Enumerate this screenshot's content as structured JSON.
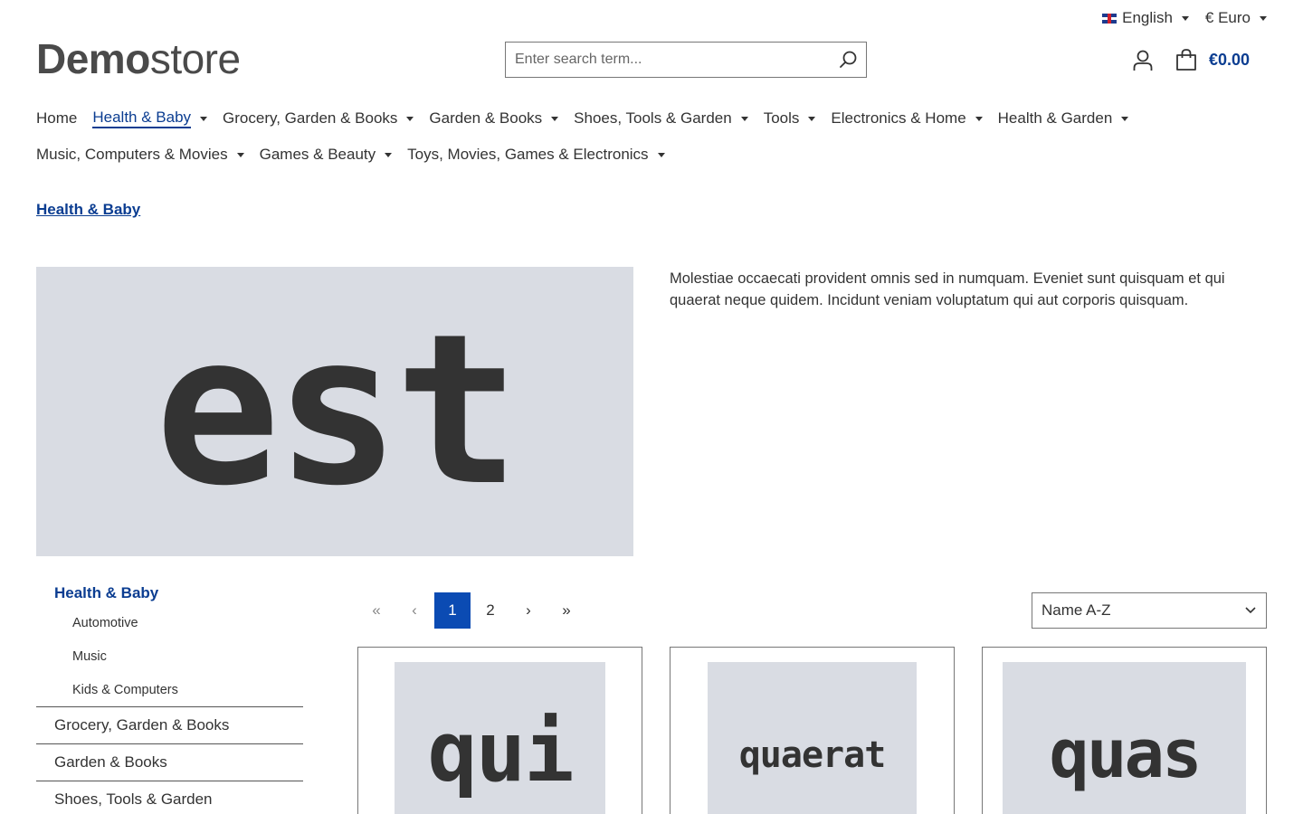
{
  "topbar": {
    "language": "English",
    "currency": "€ Euro"
  },
  "logo": {
    "bold": "Demo",
    "light": "store"
  },
  "search": {
    "placeholder": "Enter search term..."
  },
  "cart": {
    "amount": "€0.00"
  },
  "nav": [
    {
      "label": "Home"
    },
    {
      "label": "Health & Baby"
    },
    {
      "label": "Grocery, Garden & Books"
    },
    {
      "label": "Garden & Books"
    },
    {
      "label": "Shoes, Tools & Garden"
    },
    {
      "label": "Tools"
    },
    {
      "label": "Electronics & Home"
    },
    {
      "label": "Health & Garden"
    },
    {
      "label": "Music, Computers & Movies"
    },
    {
      "label": "Games & Beauty"
    },
    {
      "label": "Toys, Movies, Games & Electronics"
    }
  ],
  "breadcrumb": "Health & Baby",
  "hero": {
    "image_text": "est"
  },
  "description": "Molestiae occaecati provident omnis sed in numquam. Eveniet sunt quisquam et qui quaerat neque quidem. Incidunt veniam voluptatum qui aut corporis quisquam.",
  "sidebar": {
    "current": "Health & Baby",
    "children": [
      "Automotive",
      "Music",
      "Kids & Computers"
    ],
    "categories": [
      "Grocery, Garden & Books",
      "Garden & Books",
      "Shoes, Tools & Garden"
    ]
  },
  "pagination": {
    "first": "«",
    "prev": "‹",
    "pages": [
      "1",
      "2"
    ],
    "next": "›",
    "last": "»"
  },
  "sort": {
    "selected": "Name A-Z"
  },
  "products": [
    {
      "image_text": "qui"
    },
    {
      "image_text": "quaerat"
    },
    {
      "image_text": "quas"
    }
  ],
  "colors": {
    "accent": "#0b3d91",
    "active_page": "#0b4bb3",
    "placeholder_bg": "#d9dce3",
    "text": "#333333"
  }
}
